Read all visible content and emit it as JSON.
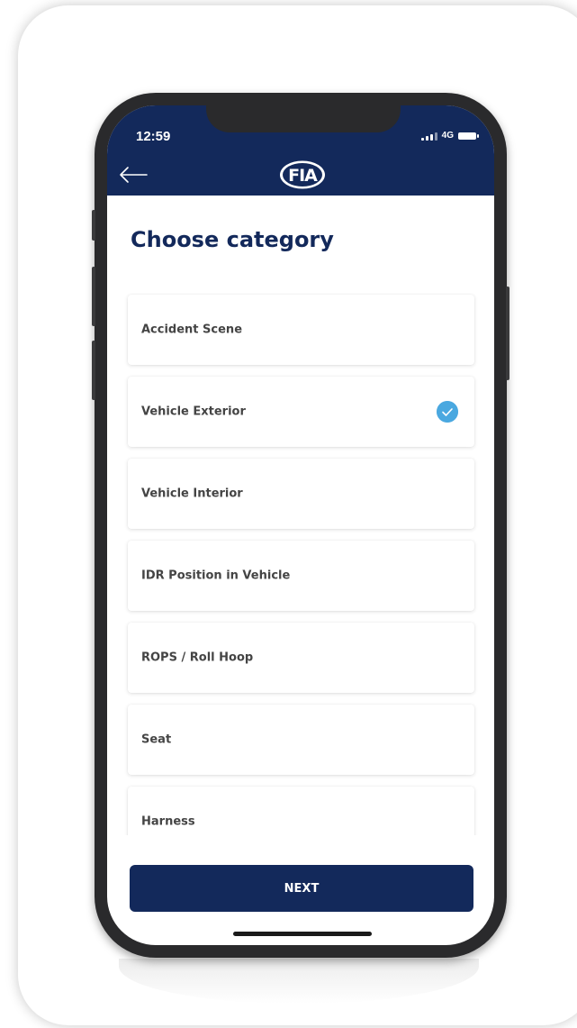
{
  "status_bar": {
    "time": "12:59",
    "network": "4G"
  },
  "header": {
    "back_icon": "arrow-left-icon",
    "logo_text": "FIA",
    "background_color": "#13295b"
  },
  "page": {
    "title": "Choose category"
  },
  "categories": [
    {
      "label": "Accident Scene",
      "selected": false
    },
    {
      "label": "Vehicle Exterior",
      "selected": true
    },
    {
      "label": "Vehicle Interior",
      "selected": false
    },
    {
      "label": "IDR Position in Vehicle",
      "selected": false
    },
    {
      "label": "ROPS / Roll Hoop",
      "selected": false
    },
    {
      "label": "Seat",
      "selected": false
    },
    {
      "label": "Harness",
      "selected": false
    }
  ],
  "selection_icon": "check-circle-icon",
  "selection_color": "#4aa8e0",
  "footer": {
    "next_label": "NEXT"
  }
}
